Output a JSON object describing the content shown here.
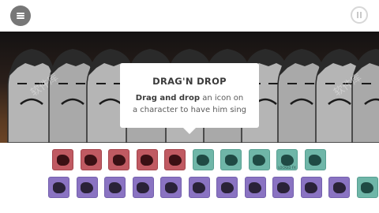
{
  "toolbar": {
    "menu_icon": "hamburger-icon",
    "pause_icon": "pause-icon"
  },
  "stage": {
    "watermark": "软件库"
  },
  "tooltip": {
    "title": "DRAG'N DROP",
    "line1_bold": "Drag and drop",
    "line1_rest": " an icon on",
    "line2": "a character to have him sing"
  },
  "palette": {
    "colors": {
      "red": "#c05a62",
      "teal": "#6fb6a8",
      "purple": "#8a73c2"
    },
    "row1": [
      {
        "color": "red",
        "icon": "beat-icon"
      },
      {
        "color": "red",
        "icon": "beat-icon"
      },
      {
        "color": "red",
        "icon": "beat-icon"
      },
      {
        "color": "red",
        "icon": "beat-icon"
      },
      {
        "color": "red",
        "icon": "beat-icon"
      },
      {
        "color": "teal",
        "icon": "effect-icon"
      },
      {
        "color": "teal",
        "icon": "effect-icon"
      },
      {
        "color": "teal",
        "icon": "effect-icon"
      },
      {
        "color": "teal",
        "icon": "effect-icon",
        "label": "LOCKED FX"
      },
      {
        "color": "teal",
        "icon": "effect-icon"
      }
    ],
    "row2": [
      {
        "color": "purple",
        "icon": "melody-icon"
      },
      {
        "color": "purple",
        "icon": "melody-icon"
      },
      {
        "color": "purple",
        "icon": "melody-icon"
      },
      {
        "color": "purple",
        "icon": "melody-icon"
      },
      {
        "color": "purple",
        "icon": "melody-icon"
      },
      {
        "color": "purple",
        "icon": "melody-icon"
      },
      {
        "color": "purple",
        "icon": "melody-icon"
      },
      {
        "color": "purple",
        "icon": "melody-icon"
      },
      {
        "color": "purple",
        "icon": "melody-icon"
      },
      {
        "color": "purple",
        "icon": "melody-icon"
      },
      {
        "color": "purple",
        "icon": "melody-icon"
      },
      {
        "color": "teal",
        "icon": "voice-icon"
      }
    ]
  }
}
